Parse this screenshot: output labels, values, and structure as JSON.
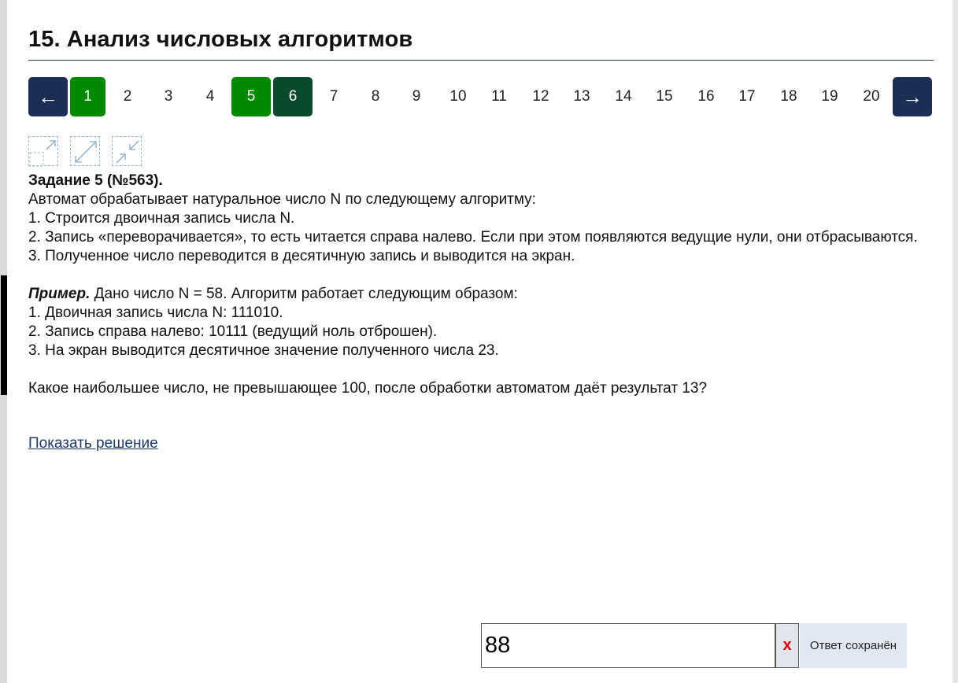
{
  "title": "15. Анализ числовых алгоритмов",
  "pagination": {
    "prev": "←",
    "next": "→",
    "pages": [
      "1",
      "2",
      "3",
      "4",
      "5",
      "6",
      "7",
      "8",
      "9",
      "10",
      "11",
      "12",
      "13",
      "14",
      "15",
      "16",
      "17",
      "18",
      "19",
      "20"
    ],
    "completed_pages": [
      "1",
      "5"
    ],
    "current_page": "6"
  },
  "tools": [
    "expand-icon",
    "fullscreen-icon",
    "collapse-icon"
  ],
  "task": {
    "title": "Задание 5 (№563).",
    "intro": "Автомат обрабатывает натуральное число N по следующему алгоритму:",
    "step1": "1. Строится двоичная запись числа N.",
    "step2": "2. Запись «переворачивается», то есть читается справа налево. Если при этом появляются ведущие нули, они отбрасываются.",
    "step3": "3. Полученное число переводится в десятичную запись и выводится на экран.",
    "example_label": "Пример.",
    "example_text": " Дано число N = 58. Алгоритм работает следующим образом:",
    "example1": "1. Двоичная запись числа N: 111010.",
    "example2": "2. Запись справа налево: 10111 (ведущий ноль отброшен).",
    "example3": "3. На экран выводится десятичное значение полученного числа 23.",
    "question": "Какое наибольшее число, не превышающее 100, после обработки автоматом даёт результат 13?"
  },
  "show_solution": "Показать решение",
  "answer": {
    "value": "88",
    "clear": "x",
    "status": "Ответ сохранён"
  },
  "colors": {
    "nav": "#1c2e55",
    "completed": "#008a00",
    "current": "#0a4a2c",
    "link": "#1c3a6b",
    "clear": "#e00000"
  }
}
